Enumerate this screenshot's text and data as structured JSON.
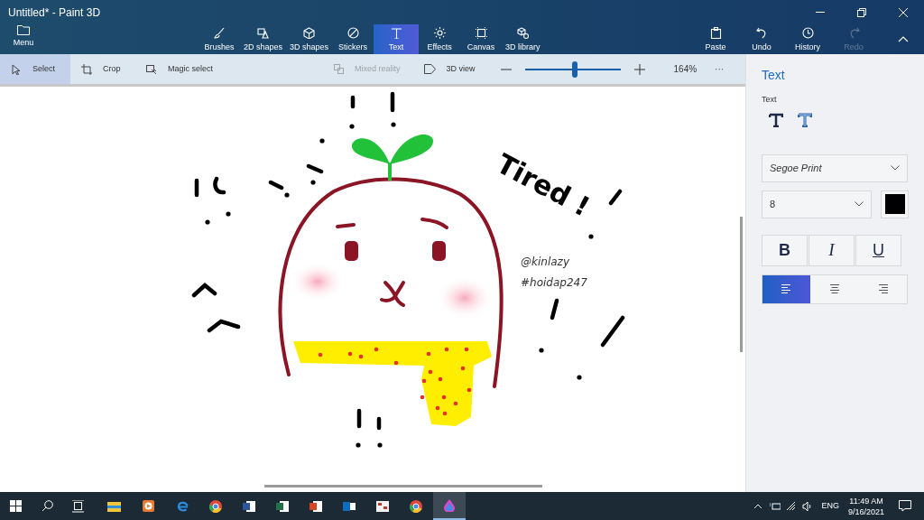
{
  "window": {
    "title": "Untitled* - Paint 3D"
  },
  "menu": {
    "label": "Menu"
  },
  "tools": [
    {
      "label": "Brushes",
      "selected": false
    },
    {
      "label": "2D shapes",
      "selected": false
    },
    {
      "label": "3D shapes",
      "selected": false
    },
    {
      "label": "Stickers",
      "selected": false
    },
    {
      "label": "Text",
      "selected": true
    },
    {
      "label": "Effects",
      "selected": false
    },
    {
      "label": "Canvas",
      "selected": false
    },
    {
      "label": "3D library",
      "selected": false
    }
  ],
  "actions": [
    {
      "label": "Paste",
      "disabled": false
    },
    {
      "label": "Undo",
      "disabled": false
    },
    {
      "label": "History",
      "disabled": false
    },
    {
      "label": "Redo",
      "disabled": true
    }
  ],
  "toolbar": {
    "items": [
      {
        "label": "Select",
        "selected": true
      },
      {
        "label": "Crop",
        "selected": false
      },
      {
        "label": "Magic select",
        "selected": false
      }
    ],
    "mixed_reality": {
      "label": "Mixed reality",
      "disabled": true
    },
    "view_3d": {
      "label": "3D view"
    },
    "zoom": {
      "level": 0.52,
      "reading": "164%"
    },
    "more": "···"
  },
  "canvas": {
    "drawn_text": "Tired !",
    "tag_lines": [
      "@kinlazy",
      "#hoidap247"
    ]
  },
  "panel": {
    "title": "Text",
    "section": "Text",
    "font": "Segoe Print",
    "size": "8",
    "color": "#000000",
    "format": [
      {
        "label": "B",
        "kind": "bold"
      },
      {
        "label": "I",
        "kind": "italic"
      },
      {
        "label": "U",
        "kind": "underline"
      }
    ],
    "align": [
      {
        "kind": "left",
        "selected": true
      },
      {
        "kind": "center",
        "selected": false
      },
      {
        "kind": "right",
        "selected": false
      }
    ]
  },
  "taskbar": {
    "language": "ENG",
    "time": "11:49 AM",
    "date": "9/16/2021"
  }
}
